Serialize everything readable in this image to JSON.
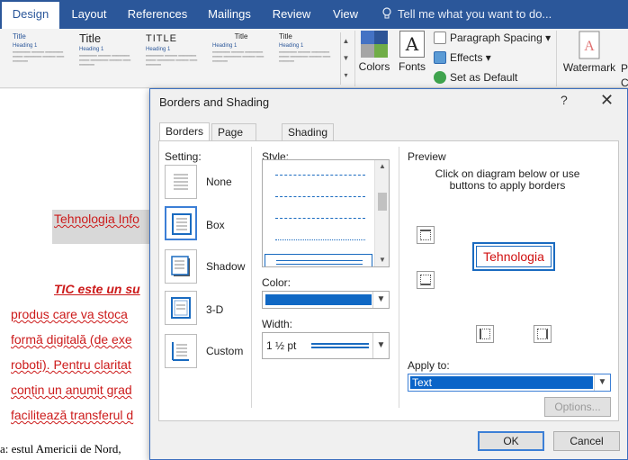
{
  "ribbon": {
    "tabs": [
      {
        "label": "Design",
        "active": true
      },
      {
        "label": "Layout"
      },
      {
        "label": "References"
      },
      {
        "label": "Mailings"
      },
      {
        "label": "Review"
      },
      {
        "label": "View"
      }
    ],
    "tell_me": "Tell me what you want to do...",
    "gallery": {
      "titles": [
        "Title",
        "Title",
        "TITLE",
        "Title",
        "Title",
        "Title"
      ],
      "headings": [
        "Heading 1",
        "Heading 1",
        "Heading 1",
        "Heading 1",
        "Heading 1",
        "Heading 1"
      ]
    },
    "colors_label": "Colors",
    "fonts_label": "Fonts",
    "fonts_glyph": "A",
    "paragraph_spacing": "Paragraph Spacing",
    "effects": "Effects",
    "set_as_default": "Set as Default",
    "watermark": "Watermark",
    "cut_labels": [
      "P",
      "C"
    ]
  },
  "document": {
    "lines": [
      "Tehnologia Info",
      "TIC este un su",
      "produs care va stoca",
      "formă digitală (de exe",
      "roboti). Pentru claritat",
      "conțin un anumit grad",
      "facilitează transferul d"
    ],
    "bottom_line": "a: estul Americii de Nord,"
  },
  "dialog": {
    "title": "Borders and Shading",
    "help": "?",
    "close": "✕",
    "tabs": [
      {
        "label": "Borders",
        "active": true
      },
      {
        "label": "Page Border"
      },
      {
        "label": "Shading"
      }
    ],
    "setting_label": "Setting:",
    "settings": [
      {
        "label": "None"
      },
      {
        "label": "Box",
        "selected": true
      },
      {
        "label": "Shadow"
      },
      {
        "label": "3-D"
      },
      {
        "label": "Custom"
      }
    ],
    "style_label": "Style:",
    "color_label": "Color:",
    "color_value": "#1068c4",
    "width_label": "Width:",
    "width_value": "1 ½ pt",
    "preview_label": "Preview",
    "preview_instructions": "Click on diagram below or use buttons to apply borders",
    "preview_sample": "Tehnologia",
    "apply_to_label": "Apply to:",
    "apply_to_value": "Text",
    "options_button": "Options...",
    "ok_button": "OK",
    "cancel_button": "Cancel"
  }
}
